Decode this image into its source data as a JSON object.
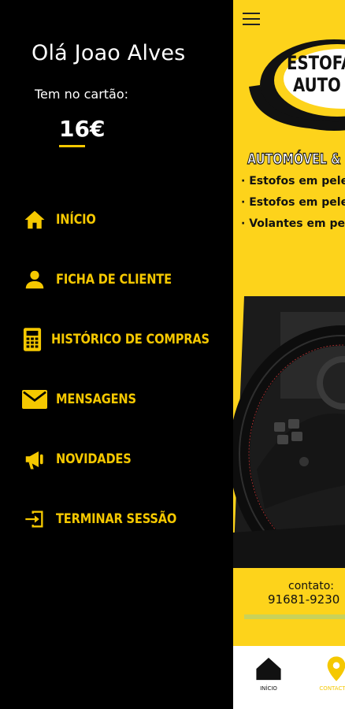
{
  "drawer": {
    "greeting": "Olá Joao Alves",
    "card_label": "Tem no cartão:",
    "balance": "16€",
    "items": [
      {
        "label": "INÍCIO",
        "icon": "home-icon"
      },
      {
        "label": "FICHA DE CLIENTE",
        "icon": "person-icon"
      },
      {
        "label": "HISTÓRICO DE COMPRAS",
        "icon": "calculator-icon"
      },
      {
        "label": "MENSAGENS",
        "icon": "envelope-icon"
      },
      {
        "label": "NOVIDADES",
        "icon": "megaphone-icon"
      },
      {
        "label": "TERMINAR SESSÃO",
        "icon": "logout-icon"
      }
    ]
  },
  "main": {
    "logo_line1": "ESTOFA",
    "logo_line2": "AUTO E",
    "category": "AUTOMÓVEL &",
    "bullets": [
      "· Estofos em pele",
      "· Estofos em pele",
      "· Volantes em pele"
    ],
    "contact_label": "contato:",
    "contact_phone": "91681-9230",
    "bottom_nav": [
      {
        "label": "INÍCIO",
        "icon": "home-icon"
      },
      {
        "label": "CONTACTOS",
        "icon": "location-pin-icon"
      }
    ]
  },
  "colors": {
    "accent": "#f5c800",
    "drawer_bg": "#000000",
    "content_bg": "#fdd31b"
  }
}
